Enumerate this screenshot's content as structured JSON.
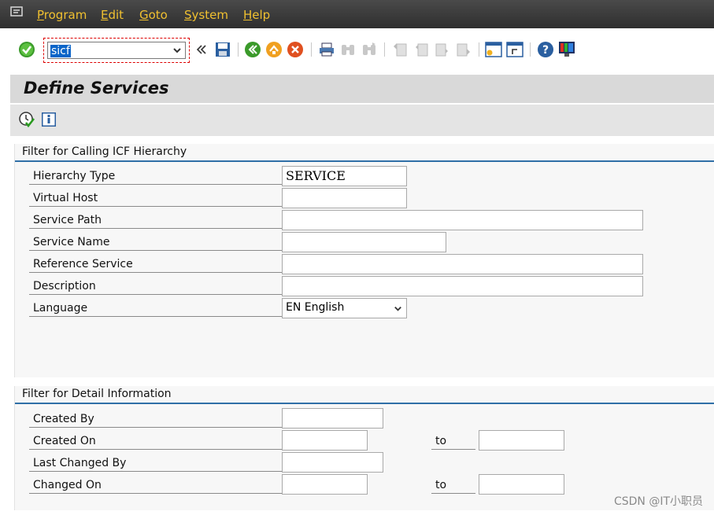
{
  "menubar": {
    "items": [
      "Program",
      "Edit",
      "Goto",
      "System",
      "Help"
    ]
  },
  "toolbar": {
    "command_value": "sicf",
    "icons": [
      "enter-icon",
      "collapse-icon",
      "save-icon",
      "back-icon",
      "exit-icon",
      "cancel-icon",
      "print-icon",
      "find-icon",
      "find-next-icon",
      "first-page-icon",
      "previous-page-icon",
      "next-page-icon",
      "last-page-icon",
      "new-session-icon",
      "shortcut-icon",
      "help-icon",
      "customize-layout-icon"
    ]
  },
  "page": {
    "title": "Define Services"
  },
  "group1": {
    "title": "Filter for Calling ICF Hierarchy",
    "rows": [
      {
        "label": "Hierarchy Type",
        "value": "SERVICE"
      },
      {
        "label": "Virtual Host",
        "value": ""
      },
      {
        "label": "Service Path",
        "value": ""
      },
      {
        "label": "Service Name",
        "value": ""
      },
      {
        "label": "Reference Service",
        "value": ""
      },
      {
        "label": "Description",
        "value": ""
      },
      {
        "label": "Language",
        "value": "EN English"
      }
    ]
  },
  "group2": {
    "title": "Filter for Detail Information",
    "rows": [
      {
        "label": "Created By",
        "value": ""
      },
      {
        "label": "Created On",
        "value": "",
        "to_label": "to",
        "to_value": ""
      },
      {
        "label": "Last Changed By",
        "value": ""
      },
      {
        "label": "Changed On",
        "value": "",
        "to_label": "to",
        "to_value": ""
      }
    ]
  },
  "watermark": "CSDN @IT小职员",
  "colors": {
    "menu_text": "#f0c030",
    "group_line": "#2f6fa7",
    "selection": "#0a64c8"
  }
}
